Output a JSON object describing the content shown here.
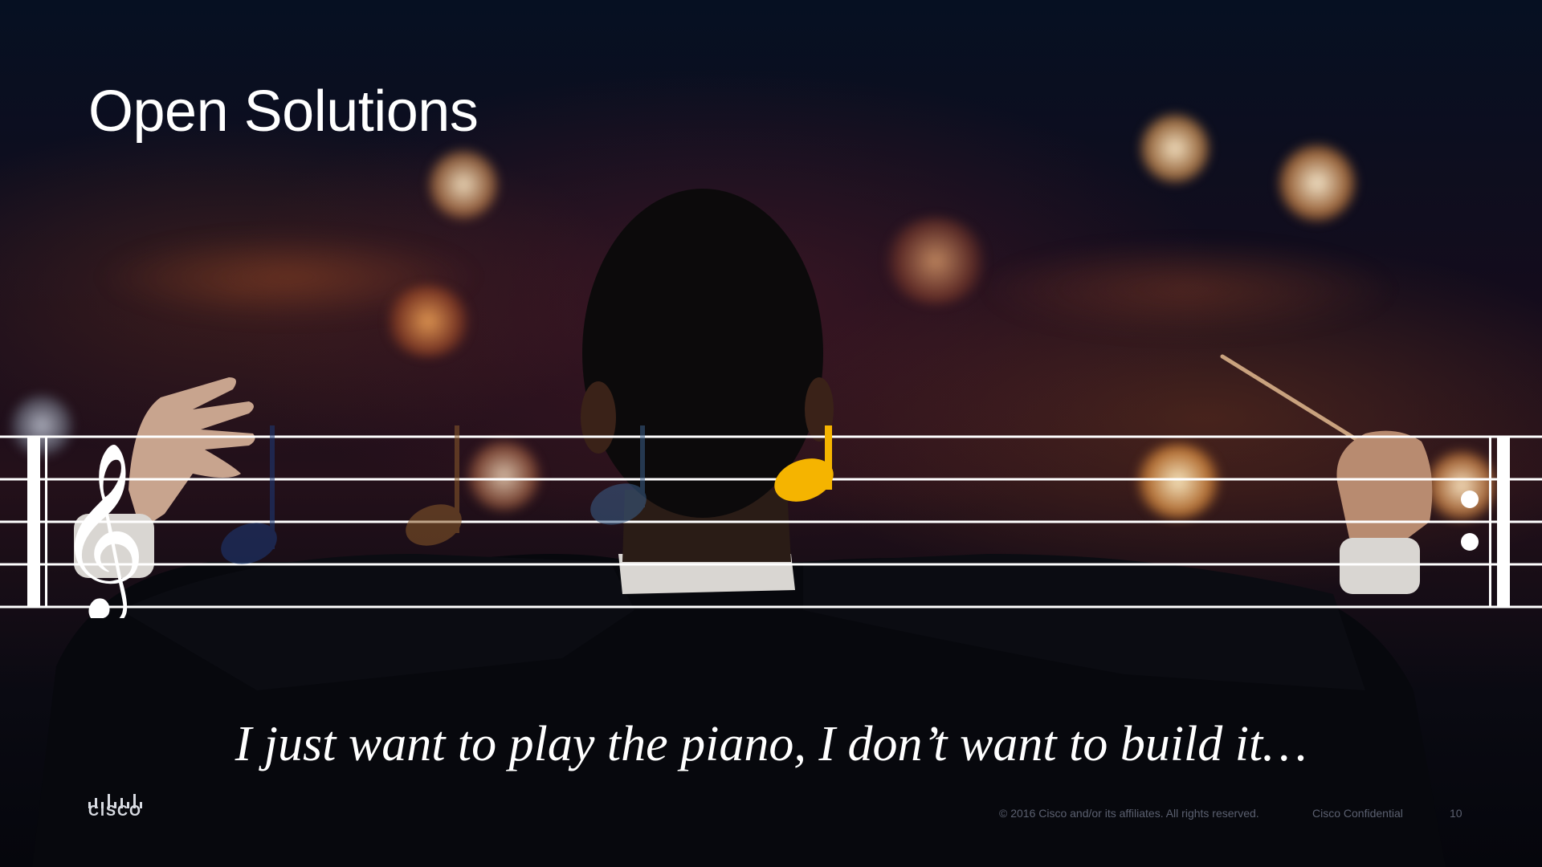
{
  "slide": {
    "title": "Open Solutions",
    "quote": "I just want to play the piano, I don’t want to build it…"
  },
  "footer": {
    "logo_text": "CISCO",
    "copyright": "© 2016  Cisco and/or its affiliates. All rights reserved.",
    "confidential": "Cisco Confidential",
    "page_number": "10"
  },
  "icons": {
    "clef": "treble-clef-icon",
    "notes": [
      "eighth-note-navy",
      "eighth-note-brown",
      "quarter-note-slate",
      "eighth-note-gold"
    ],
    "repeat": "repeat-sign-icon"
  },
  "colors": {
    "highlight_note": "#f5b400",
    "staff_lines": "#ffffff",
    "background": "#0a0a14"
  }
}
